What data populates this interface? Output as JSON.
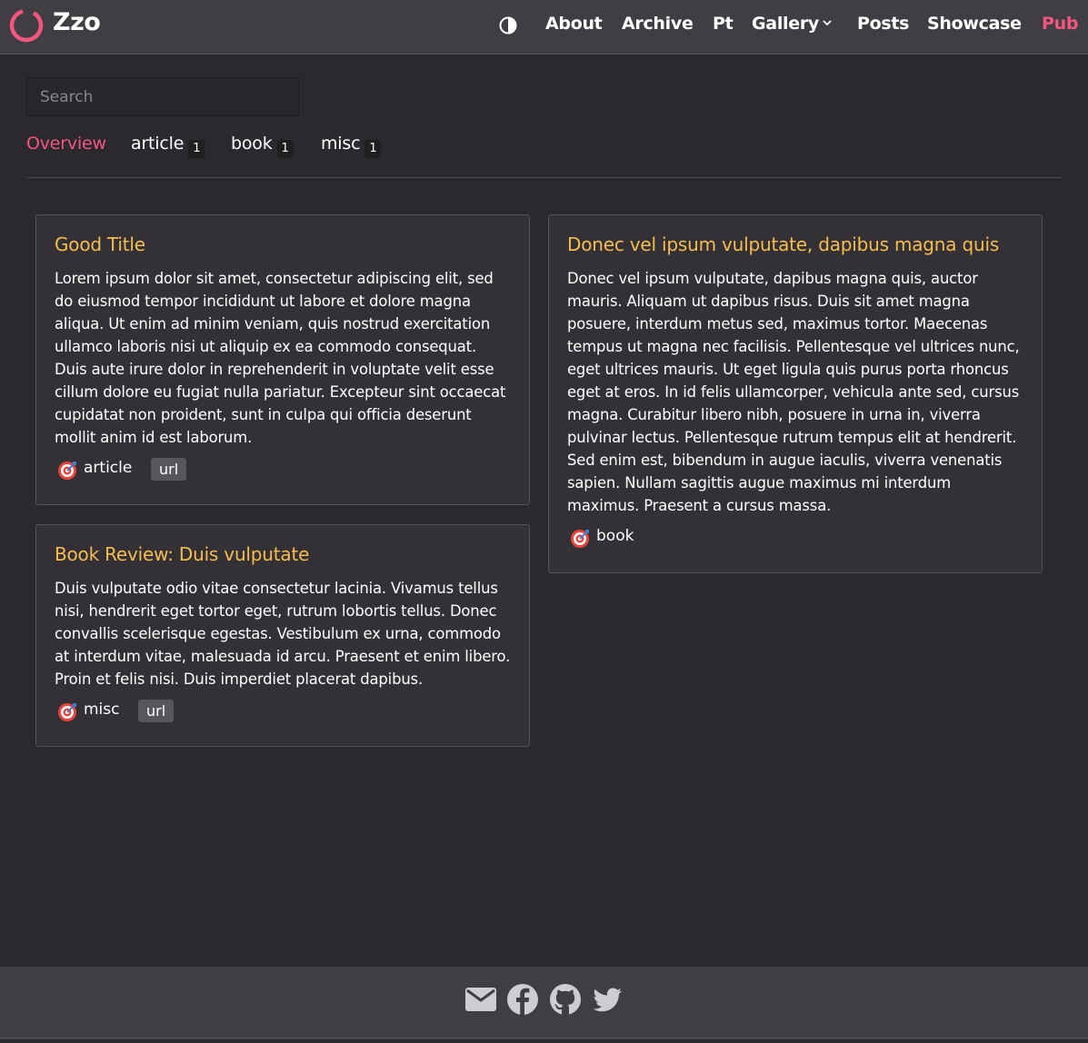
{
  "header": {
    "brand": "Zzo",
    "accent_color": "#f25780",
    "nav": [
      "About",
      "Archive",
      "Pt",
      "Gallery",
      "Posts",
      "Showcase",
      "Pub"
    ],
    "active_nav": "Pub",
    "gallery_has_dropdown": true
  },
  "search": {
    "placeholder": "Search",
    "value": ""
  },
  "tabs": [
    {
      "label": "Overview",
      "count": null,
      "active": true
    },
    {
      "label": "article",
      "count": "1"
    },
    {
      "label": "book",
      "count": "1"
    },
    {
      "label": "misc",
      "count": "1"
    }
  ],
  "cards": [
    {
      "title": "Good Title",
      "body": "Lorem ipsum dolor sit amet, consectetur adipiscing elit, sed do eiusmod tempor incididunt ut labore et dolore magna aliqua. Ut enim ad minim veniam, quis nostrud exercitation ullamco laboris nisi ut aliquip ex ea commodo consequat. Duis aute irure dolor in reprehenderit in voluptate velit esse cillum dolore eu fugiat nulla pariatur. Excepteur sint occaecat cupidatat non proident, sunt in culpa qui officia deserunt mollit anim id est laborum.",
      "category": "article",
      "link": "url"
    },
    {
      "title": "Book Review: Duis vulputate",
      "body": "Duis vulputate odio vitae consectetur lacinia. Vivamus tellus nisi, hendrerit eget tortor eget, rutrum lobortis tellus. Donec convallis scelerisque egestas. Vestibulum ex urna, commodo at interdum vitae, malesuada id arcu. Praesent et enim libero. Proin et felis nisi. Duis imperdiet placerat dapibus.",
      "category": "misc",
      "link": "url"
    },
    {
      "title": "Donec vel ipsum vulputate, dapibus magna quis",
      "body": "Donec vel ipsum vulputate, dapibus magna quis, auctor mauris. Aliquam ut dapibus risus. Duis sit amet magna posuere, interdum metus sed, maximus tortor. Maecenas tempus ut magna nec facilisis. Pellentesque vel ultrices nunc, eget ultrices mauris. Ut eget ligula quis purus porta rhoncus eget at eros. In id felis ullamcorper, vehicula ante sed, cursus magna. Curabitur libero nibh, posuere in urna in, viverra pulvinar lectus. Pellentesque rutrum tempus elit at hendrerit. Sed enim est, bibendum in augue iaculis, viverra venenatis sapien. Nullam sagittis augue maximus mi interdum maximus. Praesent a cursus massa.",
      "category": "book",
      "link": null
    }
  ],
  "colors": {
    "background": "#2b292d",
    "surface": "#403e43",
    "card": "#333136",
    "card_title": "#f6bd4e",
    "text": "#ffffff"
  },
  "icons": {
    "logo": "ring-logo-icon",
    "theme": "contrast-icon",
    "category": "target-icon",
    "footer": [
      "email-icon",
      "facebook-icon",
      "github-icon",
      "twitter-icon"
    ]
  }
}
